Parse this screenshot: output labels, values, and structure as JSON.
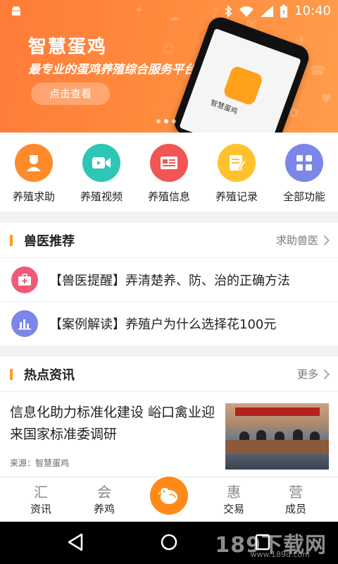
{
  "status_bar": {
    "time": "10:40"
  },
  "banner": {
    "title": "智慧蛋鸡",
    "subtitle": "最专业的蛋鸡养殖综合服务平台",
    "cta_label": "点击查看",
    "phone_app_name": "智慧蛋鸡"
  },
  "functions": [
    {
      "label": "养殖求助",
      "icon": "vet-icon",
      "color": "#ff8a2a"
    },
    {
      "label": "养殖视频",
      "icon": "video-icon",
      "color": "#2ec7b5"
    },
    {
      "label": "养殖信息",
      "icon": "news-icon",
      "color": "#f25555"
    },
    {
      "label": "养殖记录",
      "icon": "record-icon",
      "color": "#ffc12e"
    },
    {
      "label": "全部功能",
      "icon": "grid-icon",
      "color": "#7b86e8"
    }
  ],
  "vet_section": {
    "title": "兽医推荐",
    "more_label": "求助兽医",
    "items": [
      {
        "text": "【兽医提醒】弄清楚养、防、治的正确方法",
        "icon": "medkit-icon",
        "color": "#f05a78"
      },
      {
        "text": "【案例解读】养殖户为什么选择花100元",
        "icon": "chart-icon",
        "color": "#7b86e8"
      }
    ]
  },
  "news_section": {
    "title": "热点资讯",
    "more_label": "更多",
    "headline": "信息化助力标准化建设  峪口禽业迎来国家标准委调研",
    "source": "来源：智慧蛋鸡"
  },
  "tabbar": {
    "tabs": [
      {
        "label": "资讯",
        "icon": "news-tab-icon"
      },
      {
        "label": "养鸡",
        "icon": "farm-tab-icon"
      },
      {
        "label": "交易",
        "icon": "trade-tab-icon"
      },
      {
        "label": "成员",
        "icon": "member-tab-icon"
      }
    ],
    "tab_glyphs": [
      "汇",
      "会",
      "惠",
      "营"
    ]
  },
  "watermark": {
    "main": "189下载网",
    "sub": "www.189d.com"
  },
  "colors": {
    "accent": "#ff8a18",
    "banner": "#ff7b38",
    "section_bar": "#ff9c1a"
  }
}
